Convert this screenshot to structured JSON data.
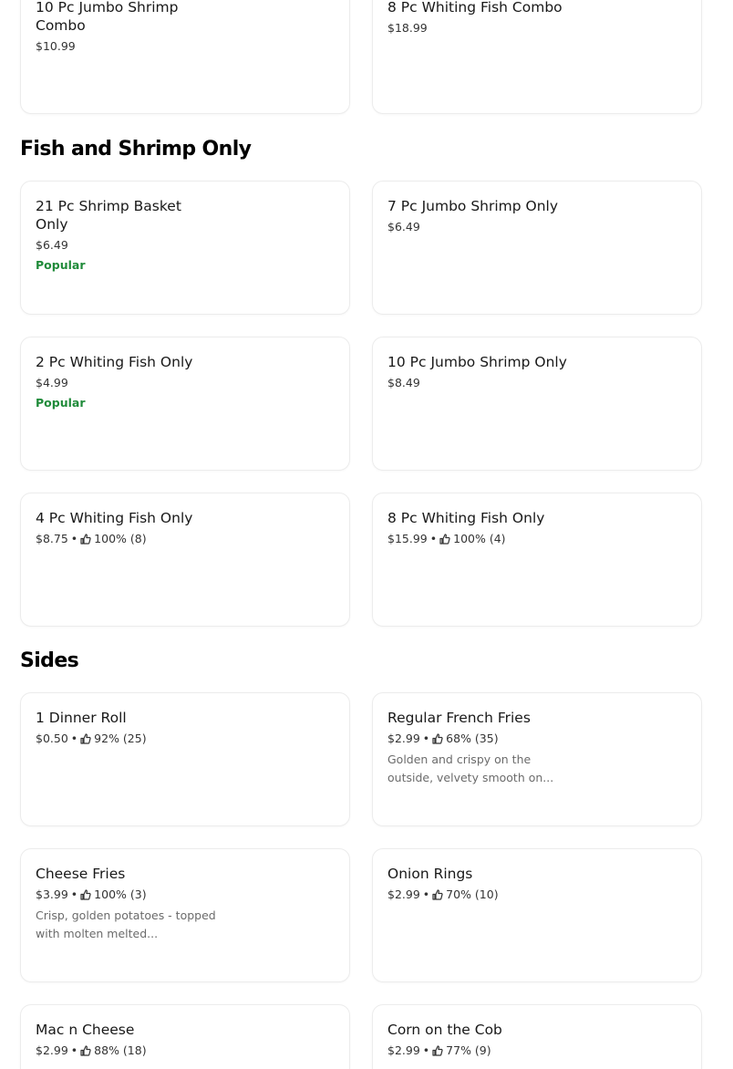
{
  "sections": {
    "combo": {
      "items": [
        {
          "name": "10 Pc Jumbo Shrimp Combo",
          "price": "$10.99"
        },
        {
          "name": "8 Pc Whiting Fish Combo",
          "price": "$18.99"
        }
      ]
    },
    "fish_shrimp": {
      "title": "Fish and Shrimp Only",
      "items": [
        {
          "name": "21 Pc Shrimp Basket Only",
          "price": "$6.49",
          "badge": "Popular"
        },
        {
          "name": "7 Pc Jumbo Shrimp Only",
          "price": "$6.49"
        },
        {
          "name": "2 Pc Whiting Fish Only",
          "price": "$4.99",
          "badge": "Popular"
        },
        {
          "name": "10 Pc Jumbo Shrimp Only",
          "price": "$8.49"
        },
        {
          "name": "4 Pc Whiting Fish Only",
          "price": "$8.75",
          "rating": "100% (8)"
        },
        {
          "name": "8 Pc Whiting Fish Only",
          "price": "$15.99",
          "rating": "100% (4)"
        }
      ]
    },
    "sides": {
      "title": "Sides",
      "items": [
        {
          "name": "1 Dinner Roll",
          "price": "$0.50",
          "rating": "92% (25)"
        },
        {
          "name": "Regular French Fries",
          "price": "$2.99",
          "rating": "68% (35)",
          "description": "Golden and crispy on the outside, velvety smooth on..."
        },
        {
          "name": "Cheese Fries",
          "price": "$3.99",
          "rating": "100% (3)",
          "description": "Crisp, golden potatoes - topped with molten melted..."
        },
        {
          "name": "Onion Rings",
          "price": "$2.99",
          "rating": "70% (10)"
        },
        {
          "name": "Mac n Cheese",
          "price": "$2.99",
          "rating": "88% (18)"
        },
        {
          "name": "Corn on the Cob",
          "price": "$2.99",
          "rating": "77% (9)"
        }
      ]
    }
  },
  "separator": "•",
  "icons": {
    "rating": "thumbs-up-icon"
  },
  "colors": {
    "popular": "#208b3a",
    "description": "#6b6b6b",
    "border": "#ececec"
  }
}
